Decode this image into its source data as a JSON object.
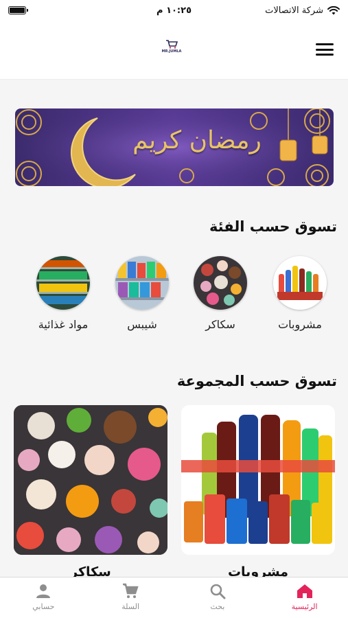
{
  "status_bar": {
    "carrier": "شركة الاتصالات",
    "time": "١٠:٢٥ م"
  },
  "header": {
    "logo_text": "MR.JUMLA"
  },
  "banner": {
    "text": "رمضان كريم"
  },
  "categories_section": {
    "title": "تسوق حسب الفئة",
    "items": [
      {
        "label": "مشروبات",
        "icon": "drinks-image"
      },
      {
        "label": "سكاكر",
        "icon": "candy-image"
      },
      {
        "label": "شيبس",
        "icon": "chips-image"
      },
      {
        "label": "مواد غذائية",
        "icon": "groceries-image"
      }
    ]
  },
  "groups_section": {
    "title": "تسوق حسب المجموعة",
    "items": [
      {
        "label": "مشروبات",
        "icon": "drinks-image"
      },
      {
        "label": "سكاكر",
        "icon": "candy-image"
      }
    ]
  },
  "tabbar": {
    "items": [
      {
        "label": "الرئيسية",
        "icon": "home-icon",
        "active": true
      },
      {
        "label": "بحث",
        "icon": "search-icon",
        "active": false
      },
      {
        "label": "السلة",
        "icon": "cart-icon",
        "active": false
      },
      {
        "label": "حسابي",
        "icon": "user-icon",
        "active": false
      }
    ]
  },
  "colors": {
    "accent": "#e3245b",
    "inactive": "#8e8e8e",
    "banner_purple": "#4b3287",
    "banner_gold": "#e8c466"
  }
}
